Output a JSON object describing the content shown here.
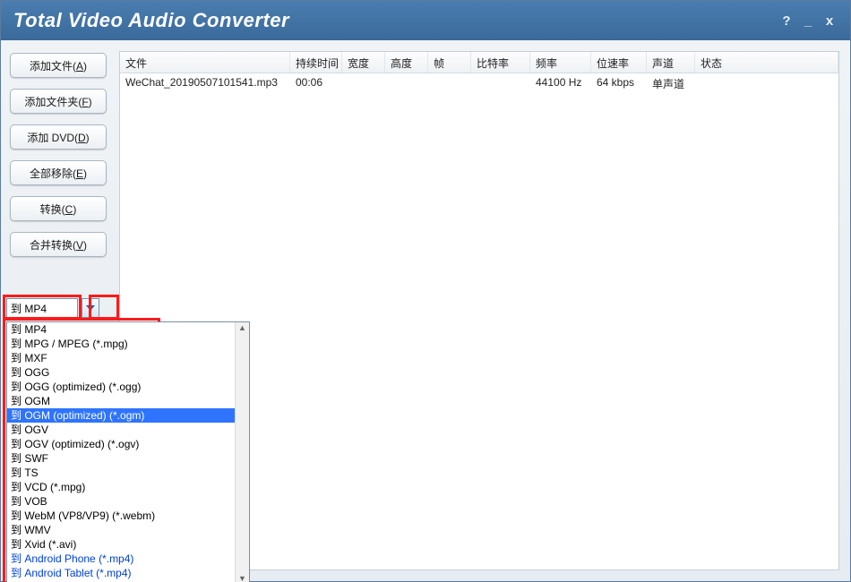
{
  "title": "Total Video Audio Converter",
  "window_controls": {
    "help": "?",
    "min": "_",
    "close": "x"
  },
  "sidebar": {
    "buttons": [
      {
        "name": "add-file-button",
        "label_pre": "添加文件(",
        "hot": "A",
        "label_post": ")"
      },
      {
        "name": "add-folder-button",
        "label_pre": "添加文件夹(",
        "hot": "F",
        "label_post": ")"
      },
      {
        "name": "add-dvd-button",
        "label_pre": "添加 DVD(",
        "hot": "D",
        "label_post": ")"
      },
      {
        "name": "remove-all-button",
        "label_pre": "全部移除(",
        "hot": "E",
        "label_post": ")"
      },
      {
        "name": "convert-button",
        "label_pre": "转换(",
        "hot": "C",
        "label_post": ")"
      },
      {
        "name": "merge-button",
        "label_pre": "合并转换(",
        "hot": "V",
        "label_post": ")"
      }
    ]
  },
  "grid": {
    "columns": [
      "文件",
      "持续时间",
      "宽度",
      "高度",
      "帧",
      "比特率",
      "频率",
      "位速率",
      "声道",
      "状态"
    ],
    "rows": [
      {
        "cells": [
          "WeChat_20190507101541.mp3",
          "00:06",
          "",
          "",
          "",
          "",
          "44100 Hz",
          "64 kbps",
          "单声道",
          ""
        ]
      }
    ]
  },
  "format_dropdown": {
    "current": "到 MP4",
    "options": [
      {
        "label": "到 MP4"
      },
      {
        "label": "到 MPG / MPEG (*.mpg)"
      },
      {
        "label": "到 MXF"
      },
      {
        "label": "到 OGG"
      },
      {
        "label": "到 OGG (optimized) (*.ogg)"
      },
      {
        "label": "到 OGM"
      },
      {
        "label": "到 OGM (optimized) (*.ogm)",
        "selected": true
      },
      {
        "label": "到 OGV"
      },
      {
        "label": "到 OGV (optimized) (*.ogv)"
      },
      {
        "label": "到 SWF"
      },
      {
        "label": "到 TS"
      },
      {
        "label": "到 VCD (*.mpg)"
      },
      {
        "label": "到 VOB"
      },
      {
        "label": "到 WebM (VP8/VP9) (*.webm)"
      },
      {
        "label": "到 WMV"
      },
      {
        "label": "到 Xvid (*.avi)"
      },
      {
        "label": "到 Android Phone (*.mp4)",
        "blue": true
      },
      {
        "label": "到 Android Tablet (*.mp4)",
        "blue": true
      }
    ]
  }
}
